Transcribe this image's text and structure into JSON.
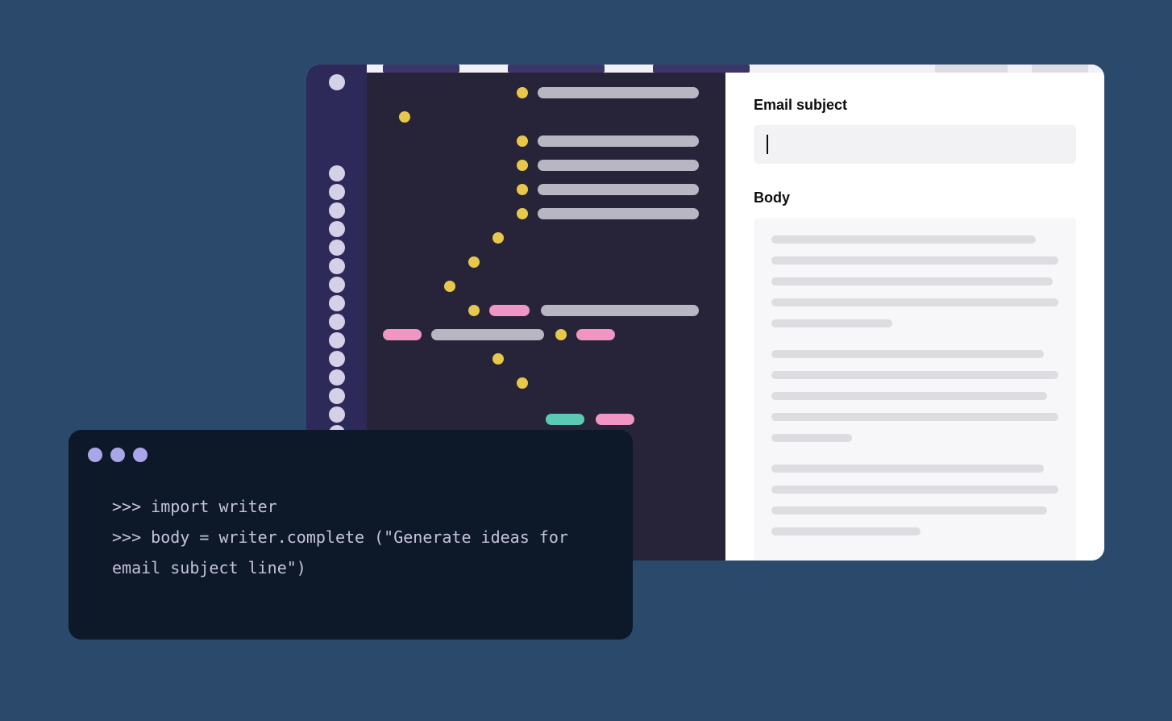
{
  "form": {
    "subject_label": "Email subject",
    "body_label": "Body"
  },
  "terminal": {
    "line1": ">>> import writer",
    "line2": ">>> body = writer.complete (\"Generate ideas for email subject line\")"
  }
}
